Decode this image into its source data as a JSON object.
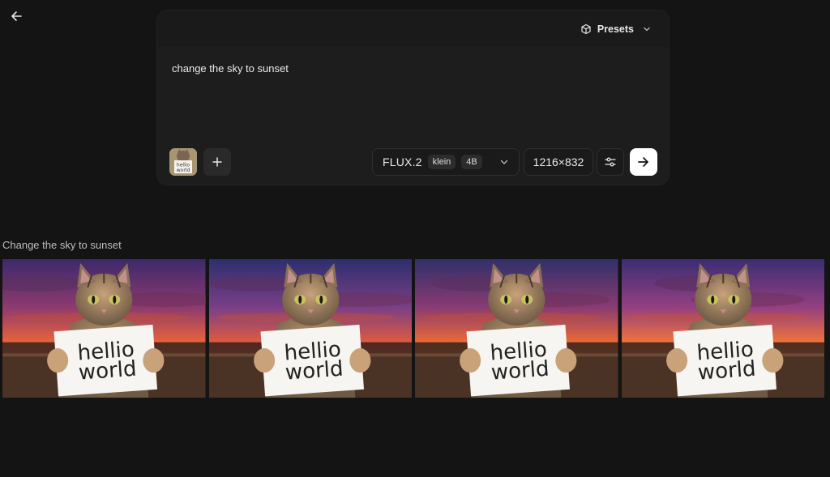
{
  "header": {
    "back_icon": "arrow-left-icon",
    "presets_label": "Presets",
    "presets_icon": "cube-icon"
  },
  "composer": {
    "prompt_value": "change the sky to sunset",
    "attachment_text_line1": "hellio",
    "attachment_text_line2": "world",
    "add_icon": "plus-icon",
    "model": {
      "name": "FLUX.2",
      "variant": "klein",
      "size": "4B"
    },
    "dimensions": "1216×832",
    "settings_icon": "sliders-icon",
    "send_icon": "arrow-right-icon"
  },
  "results": {
    "title": "Change the sky to sunset",
    "sign_line1": "hellio",
    "sign_line2": "world",
    "count": 4
  }
}
